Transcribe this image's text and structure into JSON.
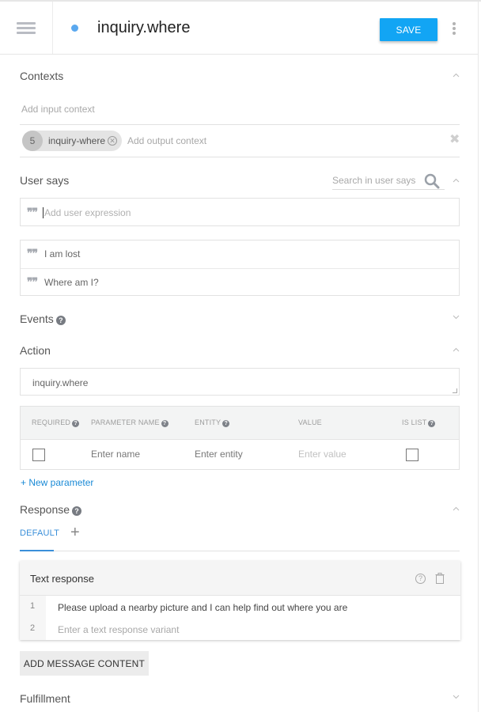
{
  "header": {
    "menu_icon": "hamburger-icon",
    "status_dot_color": "#5aa8ef",
    "title": "inquiry.where",
    "save_label": "SAVE",
    "more_icon": "more-vert-icon",
    "accent_color": "#12a5f4"
  },
  "contexts": {
    "title": "Contexts",
    "input_placeholder": "Add input context",
    "output_chips": [
      {
        "lifespan": "5",
        "name": "inquiry-where"
      }
    ],
    "output_placeholder": "Add output context"
  },
  "user_says": {
    "title": "User says",
    "search_placeholder": "Search in user says",
    "expression_placeholder": "Add user expression",
    "expressions": [
      "I am lost",
      "Where am I?"
    ]
  },
  "events": {
    "title": "Events"
  },
  "action": {
    "title": "Action",
    "value": "inquiry.where",
    "parameters": {
      "columns": [
        "REQUIRED",
        "PARAMETER NAME",
        "ENTITY",
        "VALUE",
        "IS LIST"
      ],
      "row": {
        "required": false,
        "name_placeholder": "Enter name",
        "entity_placeholder": "Enter entity",
        "value_placeholder": "Enter value",
        "is_list": false
      }
    },
    "new_parameter_label": "+ New parameter"
  },
  "response": {
    "title": "Response",
    "tabs": [
      {
        "label": "DEFAULT",
        "active": true
      }
    ],
    "add_tab_label": "+",
    "text_response": {
      "title": "Text response",
      "rows": [
        {
          "index": "1",
          "text": "Please upload a nearby picture and I can help find out where you are",
          "is_placeholder": false
        },
        {
          "index": "2",
          "text": "Enter a text response variant",
          "is_placeholder": true
        }
      ]
    },
    "add_message_content_label": "ADD MESSAGE CONTENT"
  },
  "fulfillment": {
    "title": "Fulfillment"
  }
}
